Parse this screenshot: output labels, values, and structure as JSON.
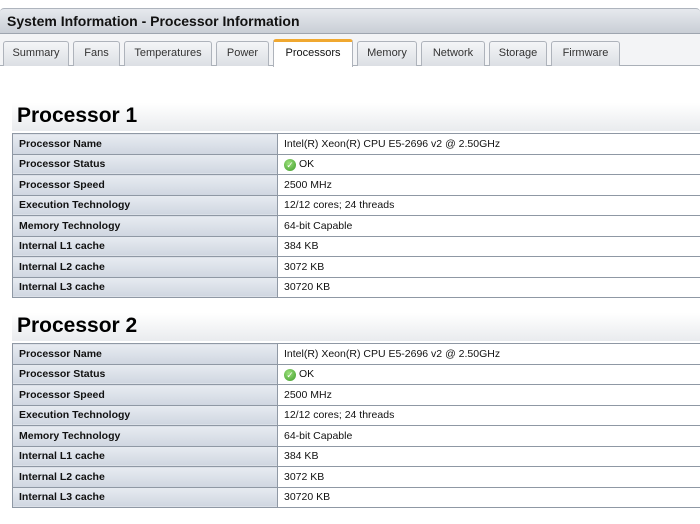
{
  "window": {
    "title": "System Information - Processor Information"
  },
  "tabs": [
    {
      "label": "Summary"
    },
    {
      "label": "Fans"
    },
    {
      "label": "Temperatures"
    },
    {
      "label": "Power"
    },
    {
      "label": "Processors",
      "active": true
    },
    {
      "label": "Memory"
    },
    {
      "label": "Network"
    },
    {
      "label": "Storage"
    },
    {
      "label": "Firmware"
    }
  ],
  "processors": [
    {
      "heading": "Processor 1",
      "rows": [
        {
          "label": "Processor Name",
          "value": "Intel(R) Xeon(R) CPU E5-2696 v2 @ 2.50GHz"
        },
        {
          "label": "Processor Status",
          "value": "OK",
          "icon": "ok-check-icon"
        },
        {
          "label": "Processor Speed",
          "value": "2500 MHz"
        },
        {
          "label": "Execution Technology",
          "value": "12/12 cores; 24 threads"
        },
        {
          "label": "Memory Technology",
          "value": "64-bit Capable"
        },
        {
          "label": "Internal L1 cache",
          "value": "384 KB"
        },
        {
          "label": "Internal L2 cache",
          "value": "3072 KB"
        },
        {
          "label": "Internal L3 cache",
          "value": "30720 KB"
        }
      ]
    },
    {
      "heading": "Processor 2",
      "rows": [
        {
          "label": "Processor Name",
          "value": "Intel(R) Xeon(R) CPU E5-2696 v2 @ 2.50GHz"
        },
        {
          "label": "Processor Status",
          "value": "OK",
          "icon": "ok-check-icon"
        },
        {
          "label": "Processor Speed",
          "value": "2500 MHz"
        },
        {
          "label": "Execution Technology",
          "value": "12/12 cores; 24 threads"
        },
        {
          "label": "Memory Technology",
          "value": "64-bit Capable"
        },
        {
          "label": "Internal L1 cache",
          "value": "384 KB"
        },
        {
          "label": "Internal L2 cache",
          "value": "3072 KB"
        },
        {
          "label": "Internal L3 cache",
          "value": "30720 KB"
        }
      ]
    }
  ],
  "colors": {
    "active_tab_accent": "#f0a830",
    "status_ok": "#3d9b2a"
  }
}
